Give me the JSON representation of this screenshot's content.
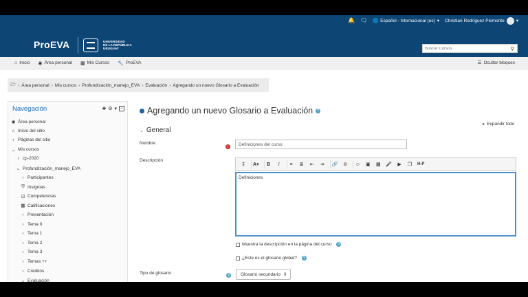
{
  "topbar": {
    "language": "Español - Internacional (es)",
    "user": "Christian Rodríguez Piemonte"
  },
  "header": {
    "logo": "ProEVA",
    "university_lines": [
      "UNIVERSIDAD",
      "DE LA REPÚBLICA",
      "URUGUAY"
    ],
    "search_placeholder": "Buscar Cursos"
  },
  "navbar": {
    "items": [
      "Inicio",
      "Área personal",
      "Mis Cursos",
      "ProEVA"
    ],
    "hide_blocks": "Ocultar bloques"
  },
  "breadcrumb": [
    "Área personal",
    "Mis cursos",
    "Profundización_manejo_EVA",
    "Evaluación",
    "Agregando un nuevo Glosario a Evaluación"
  ],
  "navblock": {
    "title": "Navegación",
    "items": [
      {
        "label": "Área personal",
        "icon": "dashboard-icon"
      },
      {
        "label": "Inicio del sitio",
        "icon": "home-icon"
      },
      {
        "label": "Páginas del sitio",
        "icon": "chevron-right-icon"
      },
      {
        "label": "Mis cursos",
        "icon": "chevron-down-icon"
      },
      {
        "label": "cp-2020",
        "icon": "chevron-right-icon"
      },
      {
        "label": "Profundización_manejo_EVA",
        "icon": "chevron-down-icon"
      },
      {
        "label": "Participantes",
        "icon": "chevron-right-icon"
      },
      {
        "label": "Insignias",
        "icon": "shield-icon"
      },
      {
        "label": "Competencias",
        "icon": "check-square-icon"
      },
      {
        "label": "Calificaciones",
        "icon": "table-icon"
      },
      {
        "label": "Presentación",
        "icon": "chevron-right-icon"
      },
      {
        "label": "Tema 0",
        "icon": "chevron-right-icon"
      },
      {
        "label": "Tema 1",
        "icon": "chevron-right-icon"
      },
      {
        "label": "Tema 2",
        "icon": "chevron-right-icon"
      },
      {
        "label": "Tema 3",
        "icon": "chevron-right-icon"
      },
      {
        "label": "Temas ++",
        "icon": "chevron-right-icon"
      },
      {
        "label": "Créditos",
        "icon": "chevron-right-icon"
      },
      {
        "label": "Evaluación",
        "icon": "chevron-down-icon"
      }
    ]
  },
  "main": {
    "title": "Agregando un nuevo Glosario a Evaluación",
    "expand_all": "Expandir todo",
    "section": "General",
    "name_label": "Nombre",
    "name_value": "Definiciones del curso",
    "description_label": "Descripción",
    "description_value": "Definiciones",
    "show_description": "Muestra la descripción en la página del curso",
    "global_glossary": "¿Este es el glosario global?",
    "glossary_type_label": "Tipo de glosario",
    "glossary_type_value": "Glosario secundario"
  },
  "colors": {
    "brand": "#0d4575",
    "link": "#0f6fc5",
    "editor_focus": "#4b8fd1"
  }
}
